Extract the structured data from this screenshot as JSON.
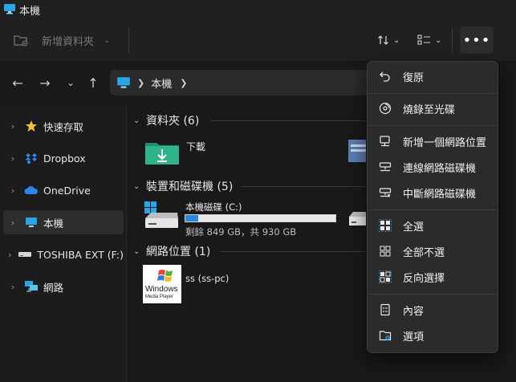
{
  "window": {
    "title": "本機"
  },
  "toolbar": {
    "new_folder_label": "新增資料夾"
  },
  "address": {
    "location": "本機"
  },
  "sidebar": {
    "items": [
      {
        "label": "快速存取"
      },
      {
        "label": "Dropbox"
      },
      {
        "label": "OneDrive"
      },
      {
        "label": "本機"
      },
      {
        "label": "TOSHIBA EXT (F:)"
      },
      {
        "label": "網路"
      }
    ]
  },
  "content": {
    "folders_group": {
      "title": "資料夾 (6)",
      "items": [
        {
          "label": "下載"
        }
      ]
    },
    "devices_group": {
      "title": "裝置和磁碟機 (5)",
      "drive": {
        "label": "本機磁碟 (C:)",
        "space": "剩餘 849 GB，共 930 GB",
        "used_fraction": 0.087
      }
    },
    "network_group": {
      "title": "網路位置 (1)",
      "item": {
        "label": "ss (ss-pc)",
        "thumb_line1": "Windows",
        "thumb_line2": "Media Player"
      }
    }
  },
  "menu": {
    "items": [
      {
        "label": "復原",
        "icon": "undo-icon"
      },
      {
        "label": "燒錄至光碟",
        "icon": "disc-burn-icon"
      },
      {
        "label": "新增一個網路位置",
        "icon": "add-network-location-icon"
      },
      {
        "label": "連線網路磁碟機",
        "icon": "map-network-drive-icon"
      },
      {
        "label": "中斷網路磁碟機",
        "icon": "disconnect-network-drive-icon"
      },
      {
        "label": "全選",
        "icon": "select-all-icon"
      },
      {
        "label": "全部不選",
        "icon": "select-none-icon"
      },
      {
        "label": "反向選擇",
        "icon": "invert-selection-icon"
      },
      {
        "label": "內容",
        "icon": "properties-icon"
      },
      {
        "label": "選項",
        "icon": "options-icon"
      }
    ]
  },
  "colors": {
    "accent": "#2c86d8",
    "folder_green": "#2fb38a",
    "menu_bg": "#2b2b2b"
  }
}
